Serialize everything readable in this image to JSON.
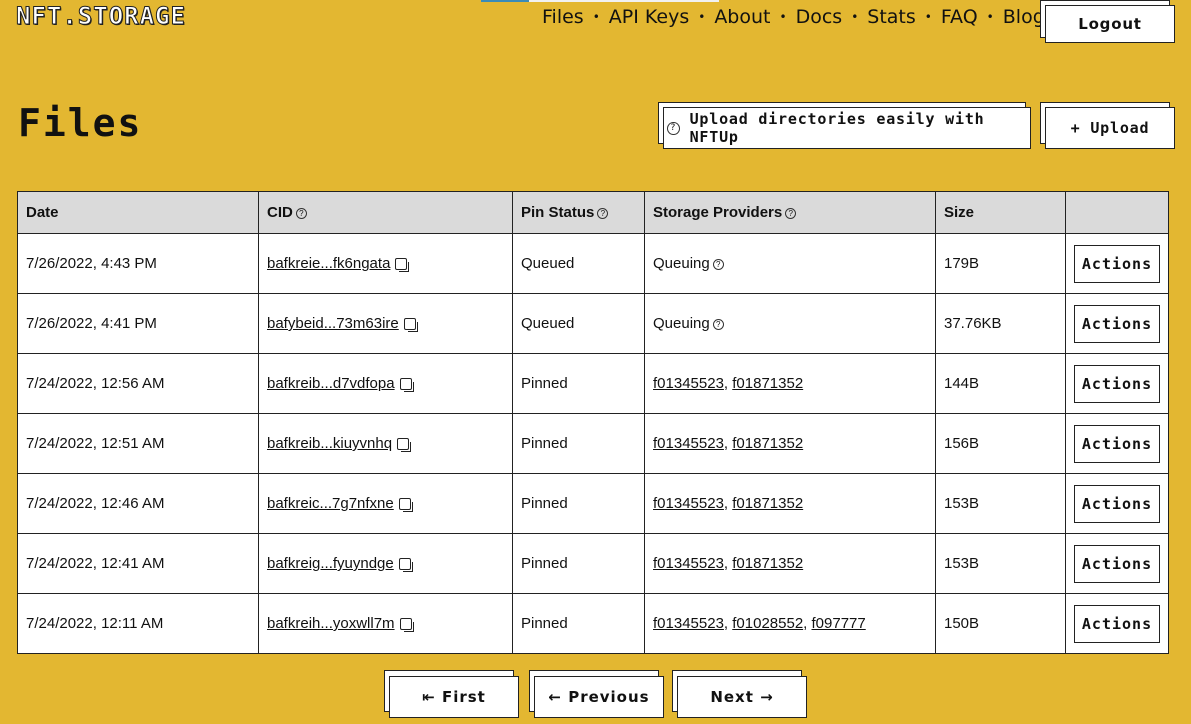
{
  "logo": "NFT.STORAGE",
  "nav": [
    "Files",
    "API Keys",
    "About",
    "Docs",
    "Stats",
    "FAQ",
    "Blog"
  ],
  "logout_label": "Logout",
  "page_title": "Files",
  "nftup_label": "Upload directories easily with NFTUp",
  "upload_label": "+ Upload",
  "table": {
    "headers": [
      "Date",
      "CID",
      "Pin Status",
      "Storage Providers",
      "Size",
      ""
    ],
    "rows": [
      {
        "date": "7/26/2022, 4:43 PM",
        "cid": "bafkreie...fk6ngata",
        "status": "Queued",
        "providers": [
          "Queuing"
        ],
        "size": "179B"
      },
      {
        "date": "7/26/2022, 4:41 PM",
        "cid": "bafybeid...73m63ire",
        "status": "Queued",
        "providers": [
          "Queuing"
        ],
        "size": "37.76KB"
      },
      {
        "date": "7/24/2022, 12:56 AM",
        "cid": "bafkreib...d7vdfopa",
        "status": "Pinned",
        "providers": [
          "f01345523",
          "f01871352"
        ],
        "size": "144B"
      },
      {
        "date": "7/24/2022, 12:51 AM",
        "cid": "bafkreib...kiuyvnhq",
        "status": "Pinned",
        "providers": [
          "f01345523",
          "f01871352"
        ],
        "size": "156B"
      },
      {
        "date": "7/24/2022, 12:46 AM",
        "cid": "bafkreic...7g7nfxne",
        "status": "Pinned",
        "providers": [
          "f01345523",
          "f01871352"
        ],
        "size": "153B"
      },
      {
        "date": "7/24/2022, 12:41 AM",
        "cid": "bafkreig...fyuyndge",
        "status": "Pinned",
        "providers": [
          "f01345523",
          "f01871352"
        ],
        "size": "153B"
      },
      {
        "date": "7/24/2022, 12:11 AM",
        "cid": "bafkreih...yoxwll7m",
        "status": "Pinned",
        "providers": [
          "f01345523",
          "f01028552",
          "f097777"
        ],
        "size": "150B"
      }
    ],
    "actions_label": "Actions"
  },
  "pagination": {
    "first": "⇤ First",
    "previous": "← Previous",
    "next": "Next →"
  },
  "icons": {
    "help": "help-circle-icon",
    "copy": "copy-icon"
  },
  "colors": {
    "background": "#e3b731",
    "header_bg": "#dadada"
  }
}
